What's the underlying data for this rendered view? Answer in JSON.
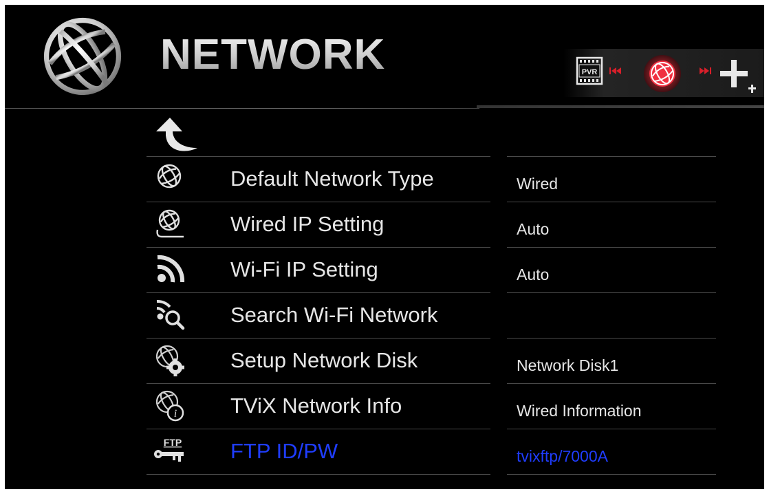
{
  "header": {
    "title": "NETWORK",
    "icon": "globe-icon"
  },
  "mode_strip": {
    "items": [
      {
        "name": "pvr-icon",
        "label": "PVR"
      },
      {
        "name": "previous-icon"
      },
      {
        "name": "network-globe-icon",
        "selected": true
      },
      {
        "name": "next-icon"
      },
      {
        "name": "plus-icon"
      }
    ]
  },
  "menu": {
    "back_icon": "back-arrow-icon",
    "items": [
      {
        "label": "Default Network Type",
        "value": "Wired",
        "icon": "globe-icon"
      },
      {
        "label": "Wired IP Setting",
        "value": "Auto",
        "icon": "wired-globe-icon"
      },
      {
        "label": "Wi-Fi IP Setting",
        "value": "Auto",
        "icon": "wifi-icon"
      },
      {
        "label": "Search Wi-Fi Network",
        "value": "",
        "icon": "wifi-search-icon"
      },
      {
        "label": "Setup Network Disk",
        "value": "Network Disk1",
        "icon": "globe-gear-icon"
      },
      {
        "label": "TViX Network Info",
        "value": "Wired Information",
        "icon": "globe-info-icon"
      },
      {
        "label": "FTP ID/PW",
        "value": "tvixftp/7000A",
        "icon": "ftp-key-icon",
        "active": true
      }
    ]
  },
  "colors": {
    "background": "#000000",
    "text": "#e6e6e6",
    "active_text": "#1f3dff",
    "accent_red": "#e0202a"
  }
}
